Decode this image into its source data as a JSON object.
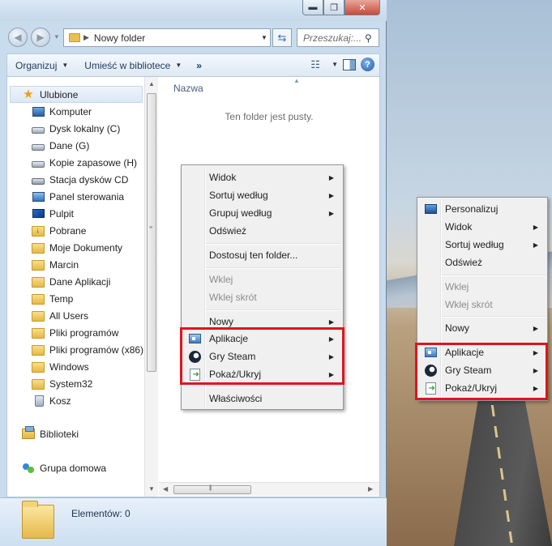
{
  "window": {
    "address": "Nowy folder",
    "search_placeholder": "Przeszukaj:...",
    "caption": {
      "minimize": "▬",
      "maximize": "❐",
      "close": "✕"
    }
  },
  "toolbar": {
    "organize": "Organizuj",
    "include_library": "Umieść w bibliotece",
    "more": "»"
  },
  "nav": {
    "favorites": "Ulubione",
    "items": [
      {
        "label": "Komputer",
        "icon": "computer-icon"
      },
      {
        "label": "Dysk lokalny (C)",
        "icon": "drive-icon"
      },
      {
        "label": "Dane (G)",
        "icon": "drive-icon"
      },
      {
        "label": "Kopie zapasowe (H)",
        "icon": "drive-icon"
      },
      {
        "label": "Stacja dysków CD",
        "icon": "cd-drive-icon"
      },
      {
        "label": "Panel sterowania",
        "icon": "control-panel-icon"
      },
      {
        "label": "Pulpit",
        "icon": "desktop-icon"
      },
      {
        "label": "Pobrane",
        "icon": "downloads-folder-icon"
      },
      {
        "label": "Moje Dokumenty",
        "icon": "folder-icon"
      },
      {
        "label": "Marcin",
        "icon": "folder-icon"
      },
      {
        "label": "Dane Aplikacji",
        "icon": "folder-icon"
      },
      {
        "label": "Temp",
        "icon": "folder-icon"
      },
      {
        "label": "All Users",
        "icon": "folder-icon"
      },
      {
        "label": "Pliki programów",
        "icon": "folder-icon"
      },
      {
        "label": "Pliki programów (x86)",
        "icon": "folder-icon"
      },
      {
        "label": "Windows",
        "icon": "folder-icon"
      },
      {
        "label": "System32",
        "icon": "folder-icon"
      },
      {
        "label": "Kosz",
        "icon": "recycle-bin-icon"
      }
    ],
    "libraries": "Biblioteki",
    "homegroup": "Grupa domowa"
  },
  "files": {
    "column_name": "Nazwa",
    "empty_message": "Ten folder jest pusty."
  },
  "details": {
    "items_count": "Elementów: 0"
  },
  "folder_menu": {
    "view": "Widok",
    "sort_by": "Sortuj według",
    "group_by": "Grupuj według",
    "refresh": "Odśwież",
    "customize": "Dostosuj ten folder...",
    "paste": "Wklej",
    "paste_shortcut": "Wklej skrót",
    "new": "Nowy",
    "apps": "Aplikacje",
    "steam_games": "Gry Steam",
    "show_hide": "Pokaż/Ukryj",
    "properties": "Właściwości"
  },
  "desktop_menu": {
    "personalize": "Personalizuj",
    "view": "Widok",
    "sort_by": "Sortuj według",
    "refresh": "Odśwież",
    "paste": "Wklej",
    "paste_shortcut": "Wklej skrót",
    "new": "Nowy",
    "apps": "Aplikacje",
    "steam_games": "Gry Steam",
    "show_hide": "Pokaż/Ukryj"
  },
  "colors": {
    "highlight_border": "#e0141e",
    "menu_background": "#f0f0f0"
  }
}
